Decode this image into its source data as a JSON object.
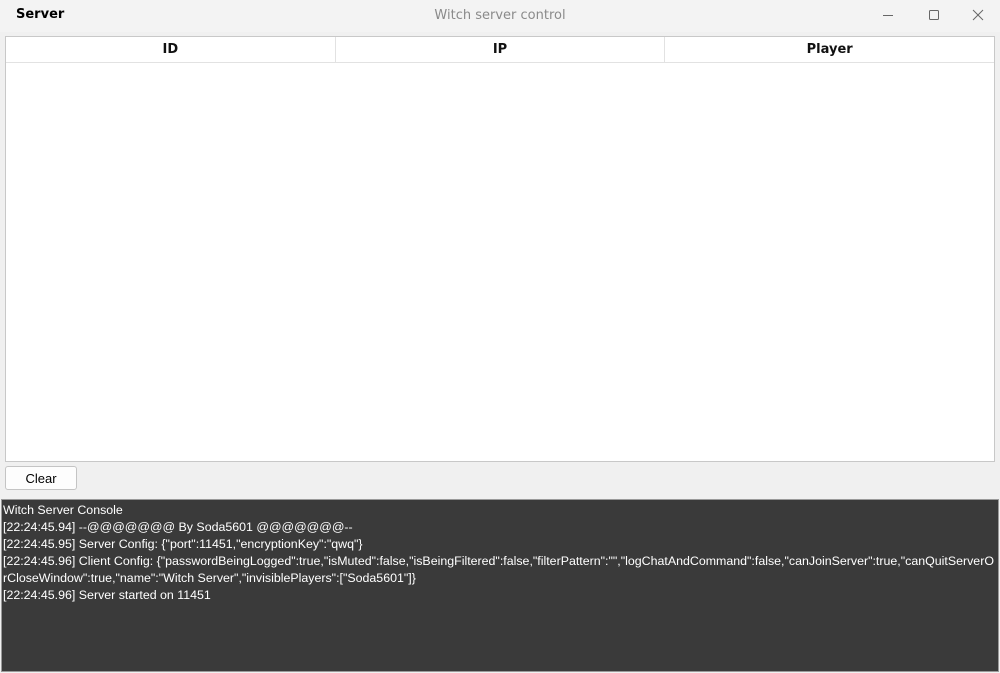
{
  "titlebar": {
    "app_name": "Server",
    "window_title": "Witch server control"
  },
  "table": {
    "columns": [
      "ID",
      "IP",
      "Player"
    ],
    "rows": []
  },
  "controls": {
    "clear_label": "Clear"
  },
  "console": {
    "lines": [
      "Witch Server Console",
      "[22:24:45.94] --@@@@@@@ By Soda5601 @@@@@@@--",
      "[22:24:45.95] Server Config: {\"port\":11451,\"encryptionKey\":\"qwq\"}",
      "[22:24:45.96] Client Config: {\"passwordBeingLogged\":true,\"isMuted\":false,\"isBeingFiltered\":false,\"filterPattern\":\"\",\"logChatAndCommand\":false,\"canJoinServer\":true,\"canQuitServerOrCloseWindow\":true,\"name\":\"Witch Server\",\"invisiblePlayers\":[\"Soda5601\"]}",
      "[22:24:45.96] Server started on 11451"
    ]
  },
  "colors": {
    "console_background": "#3a3a3a",
    "console_text": "#ffffff",
    "window_background": "#f0f0f0",
    "table_background": "#ffffff"
  },
  "icons": {
    "minimize": "minimize-icon",
    "maximize": "maximize-icon",
    "close": "close-icon"
  }
}
